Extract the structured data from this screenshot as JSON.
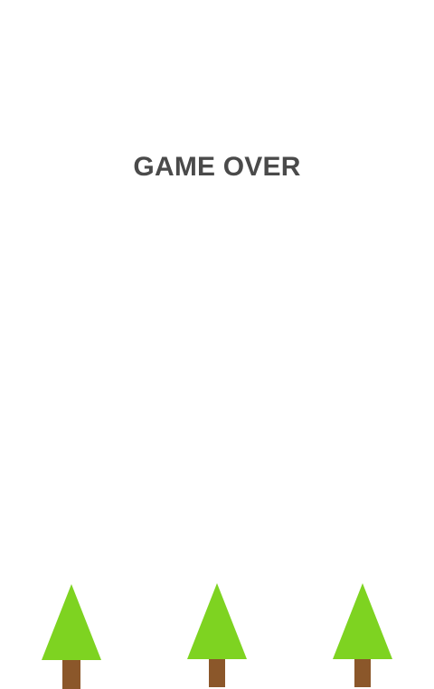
{
  "game": {
    "status_text": "GAME OVER"
  },
  "colors": {
    "background": "#ffffff",
    "text": "#4a4a4a",
    "tree_foliage": "#7ed321",
    "tree_trunk": "#8b572a"
  },
  "trees": [
    {
      "name": "tree-left",
      "icon": "pine-tree-icon"
    },
    {
      "name": "tree-center",
      "icon": "pine-tree-icon"
    },
    {
      "name": "tree-right",
      "icon": "pine-tree-icon"
    }
  ]
}
